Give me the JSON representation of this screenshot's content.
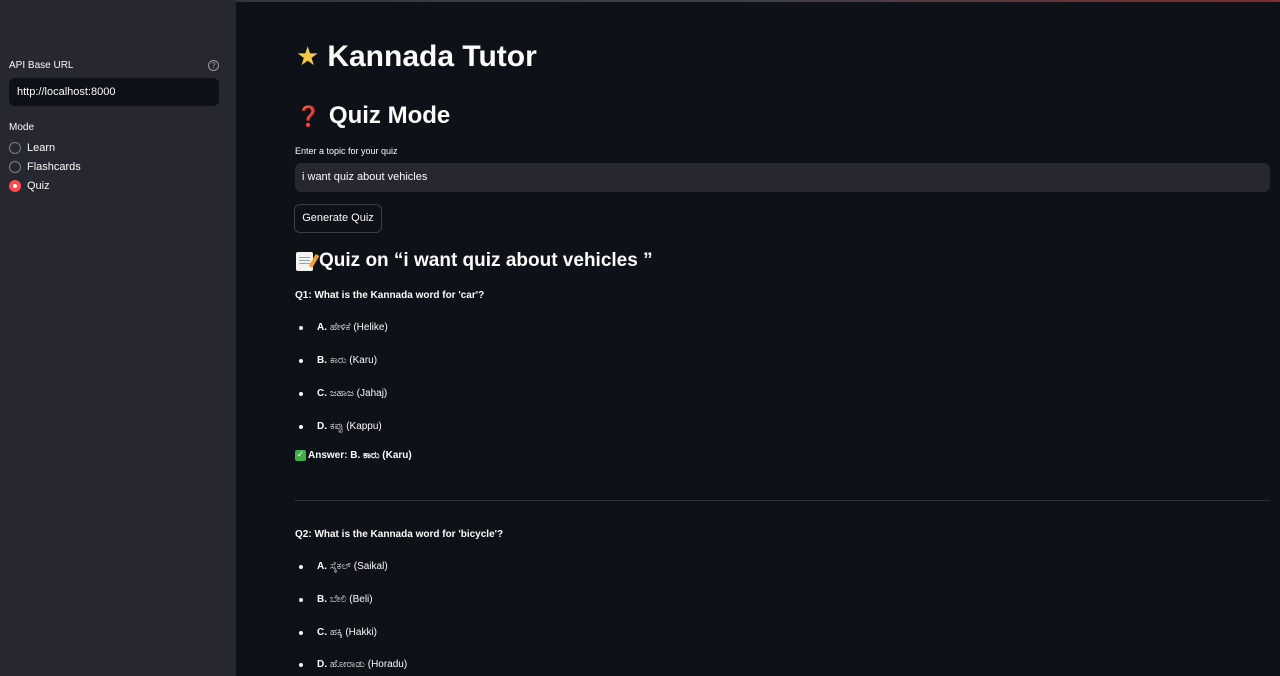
{
  "sidebar": {
    "api_label": "API Base URL",
    "api_value": "http://localhost:8000",
    "mode_label": "Mode",
    "modes": [
      {
        "label": "Learn",
        "checked": false
      },
      {
        "label": "Flashcards",
        "checked": false
      },
      {
        "label": "Quiz",
        "checked": true
      }
    ]
  },
  "main": {
    "title": "Kannada Tutor",
    "title_icon": "glowing-star-icon",
    "subtitle": "Quiz Mode",
    "subtitle_icon": "question-mark-icon",
    "topic_label": "Enter a topic for your quiz",
    "topic_value": "i want quiz about vehicles",
    "generate_label": "Generate Quiz",
    "quiz_heading": "Quiz on “i want quiz about vehicles ”",
    "quiz_heading_icon": "memo-icon"
  },
  "quiz": [
    {
      "question": "Q1: What is the Kannada word for 'car'?",
      "options": [
        {
          "letter": "A.",
          "text": "ಹೇಳಿಕೆ (Helike)"
        },
        {
          "letter": "B.",
          "text": "ಕಾರು (Karu)"
        },
        {
          "letter": "C.",
          "text": "ಜಹಾಜ (Jahaj)"
        },
        {
          "letter": "D.",
          "text": "ಕಪ್ಪು (Kappu)"
        }
      ],
      "answer": "Answer: B. ಕಾರು (Karu)"
    },
    {
      "question": "Q2: What is the Kannada word for 'bicycle'?",
      "options": [
        {
          "letter": "A.",
          "text": "ಸೈಕಲ್ (Saikal)"
        },
        {
          "letter": "B.",
          "text": "ಬೇಲಿ (Beli)"
        },
        {
          "letter": "C.",
          "text": "ಹಕ್ಕಿ (Hakki)"
        },
        {
          "letter": "D.",
          "text": "ಹೋರಾಡು (Horadu)"
        }
      ]
    }
  ],
  "colors": {
    "background": "#0e1117",
    "sidebar": "#262730",
    "accent": "#ff4b4b",
    "answer_check": "#3fae49"
  }
}
